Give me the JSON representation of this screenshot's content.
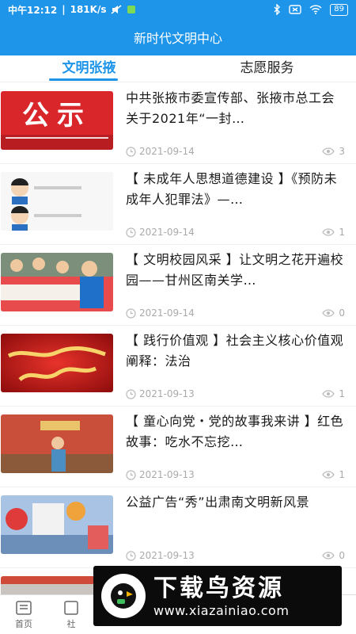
{
  "status_bar": {
    "time": "中午12:12",
    "speed": "181K/s",
    "battery": "89"
  },
  "header": {
    "title": "新时代文明中心"
  },
  "tabs": [
    {
      "label": "文明张掖",
      "active": true
    },
    {
      "label": "志愿服务",
      "active": false
    }
  ],
  "articles": [
    {
      "title": "中共张掖市委宣传部、张掖市总工会关于2021年“一封…",
      "date": "2021-09-14",
      "views": "3",
      "thumb_icon": "gongshi-banner-image"
    },
    {
      "title": "【 未成年人思想道德建设 】《预防未成年人犯罪法》—…",
      "date": "2021-09-14",
      "views": "1",
      "thumb_icon": "cartoon-student-image"
    },
    {
      "title": "【 文明校园风采 】让文明之花开遍校园——甘州区南关学…",
      "date": "2021-09-14",
      "views": "0",
      "thumb_icon": "students-writing-image"
    },
    {
      "title": "【 践行价值观 】社会主义核心价值观阐释：法治",
      "date": "2021-09-13",
      "views": "1",
      "thumb_icon": "calligraphy-red-image"
    },
    {
      "title": "【 童心向党・党的故事我来讲 】红色故事：吃水不忘挖…",
      "date": "2021-09-13",
      "views": "1",
      "thumb_icon": "child-storyteller-image"
    },
    {
      "title": "公益广告“秀”出肃南文明新风景",
      "date": "2021-09-13",
      "views": "0",
      "thumb_icon": "public-ad-image"
    }
  ],
  "bottom_nav": [
    {
      "label": "首页",
      "icon": "home-icon"
    },
    {
      "label": "社",
      "icon": "community-icon"
    }
  ],
  "watermark": {
    "title": "下载鸟资源",
    "url": "www.xiazainiao.com"
  },
  "colors": {
    "accent": "#1e95e9",
    "text": "#1a1a1a",
    "meta": "#aaaaaa"
  }
}
